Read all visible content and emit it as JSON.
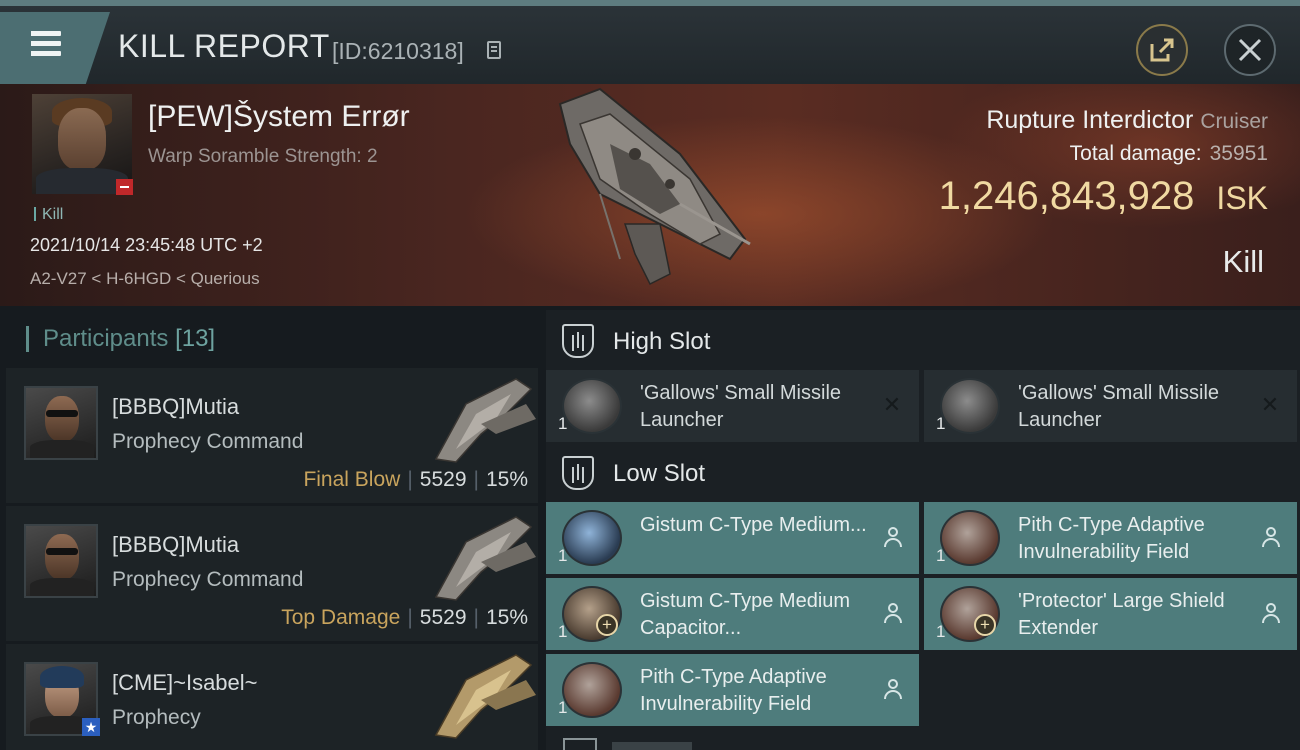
{
  "header": {
    "title": "KILL REPORT",
    "report_id": "[ID:6210318]",
    "icons": [
      "menu-icon",
      "copy-icon",
      "share-icon",
      "close-icon"
    ]
  },
  "victim": {
    "pilot": "[PEW]Šystem Errør",
    "warp_text": "Warp Soramble Strength: 2",
    "tag": "Kill",
    "datetime": "2021/10/14 23:45:48 UTC +2",
    "location": "A2-V27 < H-6HGD < Querious",
    "ship_name": "Rupture Interdictor",
    "ship_class": "Cruiser",
    "total_damage_label": "Total damage:",
    "total_damage": "35951",
    "isk_value": "1,246,843,928",
    "isk_unit": "ISK",
    "result": "Kill"
  },
  "participants": {
    "label": "Participants",
    "count": "[13]",
    "items": [
      {
        "name": "[BBBQ]Mutia",
        "ship": "Prophecy Command",
        "role": "Final Blow",
        "damage": "5529",
        "percent": "15%"
      },
      {
        "name": "[BBBQ]Mutia",
        "ship": "Prophecy Command",
        "role": "Top Damage",
        "damage": "5529",
        "percent": "15%"
      },
      {
        "name": "[CME]~Isabel~",
        "ship": "Prophecy",
        "role": "",
        "damage": "",
        "percent": ""
      }
    ]
  },
  "fitting": {
    "high_slot": {
      "label": "High Slot",
      "modules": [
        {
          "qty": "1",
          "name": "'Gallows' Small Missile Launcher"
        },
        {
          "qty": "1",
          "name": "'Gallows' Small Missile Launcher"
        }
      ]
    },
    "low_slot": {
      "label": "Low Slot",
      "modules": [
        {
          "qty": "1",
          "name": "Gistum C-Type Medium..."
        },
        {
          "qty": "1",
          "name": "Pith C-Type Adaptive Invulnerability Field"
        },
        {
          "qty": "1",
          "name": "Gistum C-Type Medium Capacitor..."
        },
        {
          "qty": "1",
          "name": "'Protector' Large Shield Extender"
        },
        {
          "qty": "1",
          "name": "Pith C-Type Adaptive Invulnerability Field"
        }
      ]
    }
  },
  "colors": {
    "accent_teal": "#4e7c7c",
    "isk_gold": "#f0d9a2",
    "role_gold": "#c9a45d",
    "badge_red": "#c0282a"
  }
}
